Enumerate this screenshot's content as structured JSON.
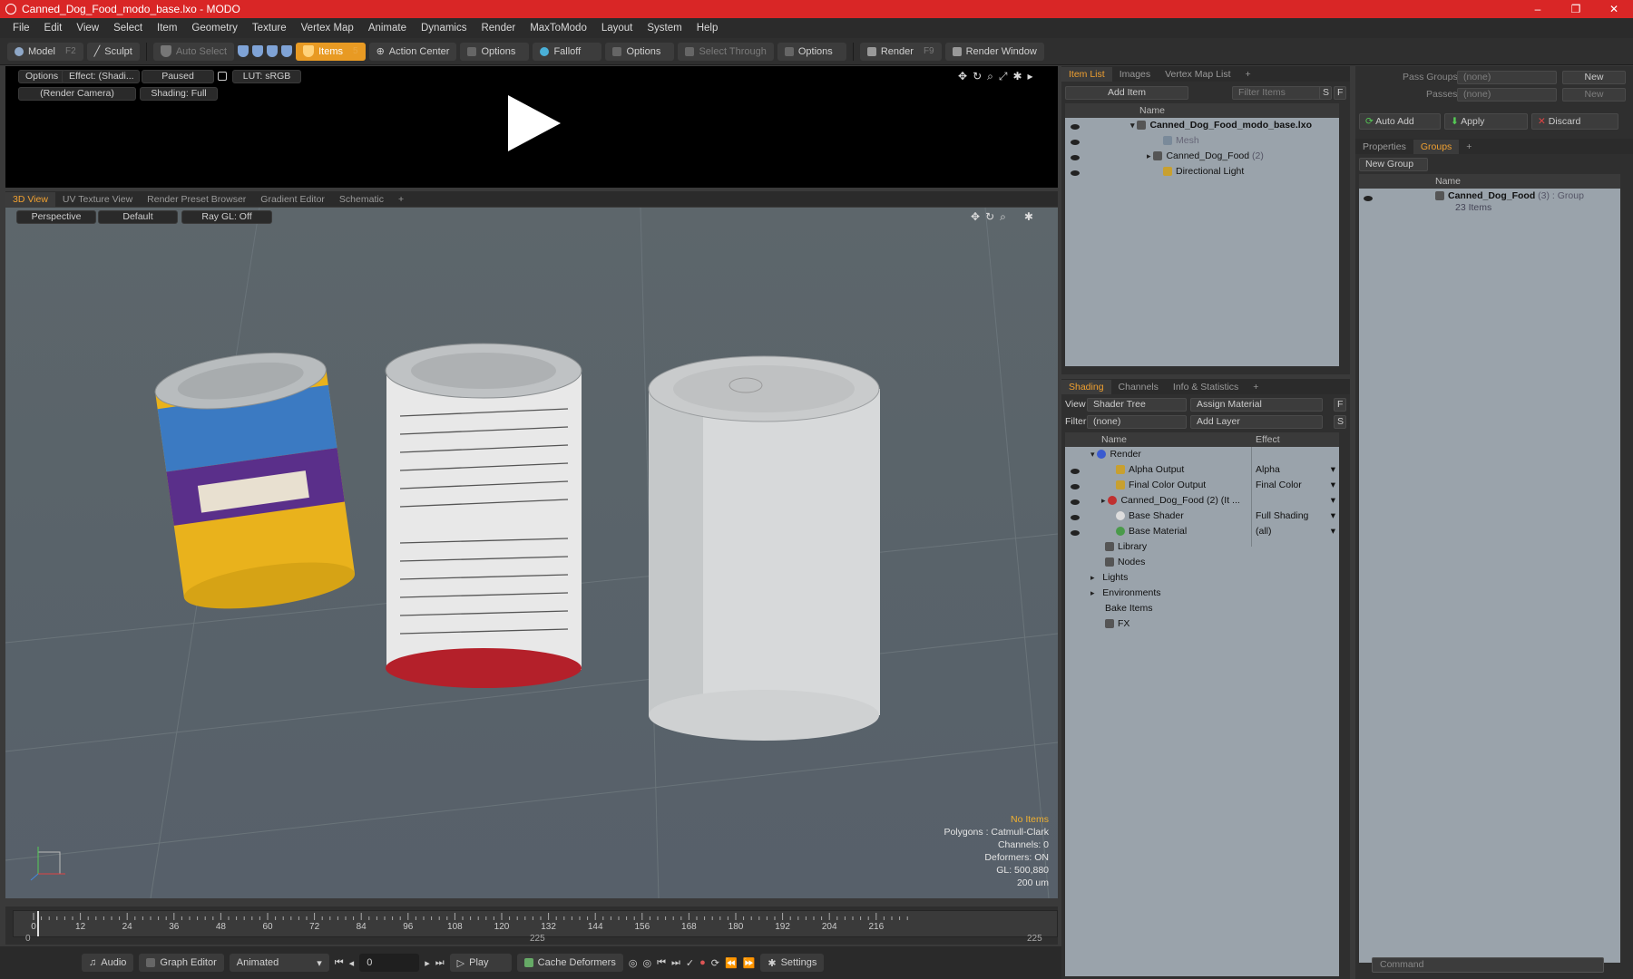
{
  "window": {
    "title": "Canned_Dog_Food_modo_base.lxo - MODO",
    "min": "–",
    "max": "❐",
    "close": "✕"
  },
  "menu": [
    "File",
    "Edit",
    "View",
    "Select",
    "Item",
    "Geometry",
    "Texture",
    "Vertex Map",
    "Animate",
    "Dynamics",
    "Render",
    "MaxToModo",
    "Layout",
    "System",
    "Help"
  ],
  "toolbar": {
    "model": "Model",
    "model_key": "F2",
    "sculpt": "Sculpt",
    "auto_select": "Auto Select",
    "items": "Items",
    "items_key": "5",
    "action_center": "Action Center",
    "options1": "Options",
    "falloff": "Falloff",
    "options2": "Options",
    "select_through": "Select Through",
    "options3": "Options",
    "render": "Render",
    "render_key": "F9",
    "render_window": "Render Window"
  },
  "preview": {
    "options": "Options",
    "effect": "Effect: (Shadi...",
    "paused": "Paused",
    "lut": "LUT: sRGB",
    "camera": "(Render Camera)",
    "shading": "Shading: Full"
  },
  "view_tabs": [
    "3D View",
    "UV Texture View",
    "Render Preset Browser",
    "Gradient Editor",
    "Schematic",
    "+"
  ],
  "viewport": {
    "perspective": "Perspective",
    "default": "Default",
    "raygl": "Ray GL: Off",
    "info": {
      "no_items": "No Items",
      "polygons": "Polygons : Catmull-Clark",
      "channels": "Channels: 0",
      "deformers": "Deformers: ON",
      "gl": "GL: 500,880",
      "scale": "200 um"
    }
  },
  "timeline": {
    "ticks": [
      "0",
      "12",
      "24",
      "36",
      "48",
      "60",
      "72",
      "84",
      "96",
      "108",
      "120",
      "132",
      "144",
      "156",
      "168",
      "180",
      "192",
      "204",
      "216"
    ],
    "start": "0",
    "mid": "225",
    "end": "225"
  },
  "bottom": {
    "audio": "Audio",
    "graph_editor": "Graph Editor",
    "animated": "Animated",
    "frame": "0",
    "play": "Play",
    "cache": "Cache Deformers",
    "settings": "Settings"
  },
  "item_list": {
    "tabs": [
      "Item List",
      "Images",
      "Vertex Map List",
      "+"
    ],
    "add_item": "Add Item",
    "filter": "Filter Items",
    "s": "S",
    "f": "F",
    "col_name": "Name",
    "rows": [
      {
        "label": "Canned_Dog_Food_modo_base.lxo",
        "extra": ""
      },
      {
        "label": "Mesh",
        "extra": ""
      },
      {
        "label": "Canned_Dog_Food",
        "extra": "(2)"
      },
      {
        "label": "Directional Light",
        "extra": ""
      }
    ]
  },
  "shading": {
    "tabs": [
      "Shading",
      "Channels",
      "Info & Statistics",
      "+"
    ],
    "view_label": "View",
    "view_value": "Shader Tree",
    "assign": "Assign Material",
    "f": "F",
    "filter_label": "Filter",
    "filter_value": "(none)",
    "add_layer": "Add Layer",
    "s": "S",
    "col_name": "Name",
    "col_effect": "Effect",
    "rows": [
      {
        "label": "Render",
        "effect": ""
      },
      {
        "label": "Alpha Output",
        "effect": "Alpha"
      },
      {
        "label": "Final Color Output",
        "effect": "Final Color"
      },
      {
        "label": "Canned_Dog_Food (2) (It ...",
        "effect": ""
      },
      {
        "label": "Base Shader",
        "effect": "Full Shading"
      },
      {
        "label": "Base Material",
        "effect": "(all)"
      },
      {
        "label": "Library",
        "effect": ""
      },
      {
        "label": "Nodes",
        "effect": ""
      },
      {
        "label": "Lights",
        "effect": ""
      },
      {
        "label": "Environments",
        "effect": ""
      },
      {
        "label": "Bake Items",
        "effect": ""
      },
      {
        "label": "FX",
        "effect": ""
      }
    ]
  },
  "groups_panel": {
    "pass_groups": "Pass Groups",
    "passes": "Passes",
    "none": "(none)",
    "new": "New",
    "auto_add": "Auto Add",
    "apply": "Apply",
    "discard": "Discard",
    "tabs": [
      "Properties",
      "Groups",
      "+"
    ],
    "new_group": "New Group",
    "col_name": "Name",
    "group_name": "Canned_Dog_Food",
    "group_extra": "(3) : Group",
    "group_items": "23 Items"
  },
  "command": "Command",
  "colors": {
    "accent": "#e89a23",
    "title": "#d92626"
  }
}
